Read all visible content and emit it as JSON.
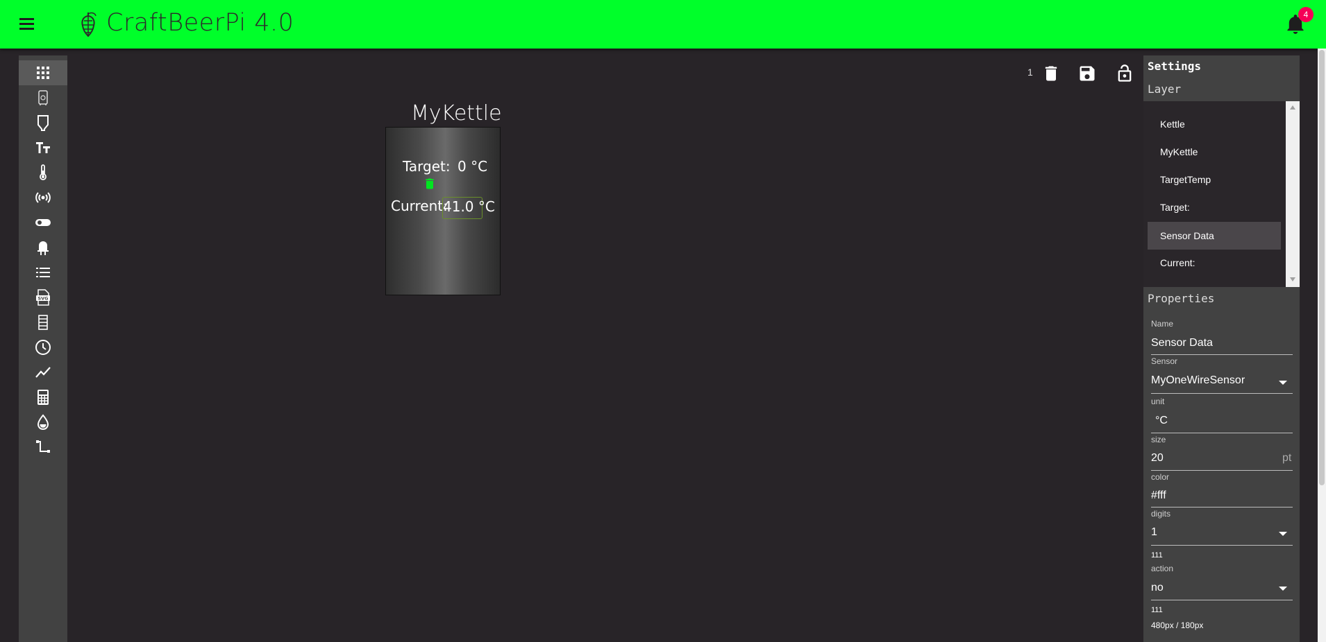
{
  "app": {
    "title": "CraftBeerPi 4.0",
    "notification_count": "4"
  },
  "sidebar": {
    "tools": [
      {
        "icon": "grid-icon"
      },
      {
        "icon": "kettle-icon"
      },
      {
        "icon": "fermenter-icon"
      },
      {
        "icon": "text-icon"
      },
      {
        "icon": "thermometer-icon"
      },
      {
        "icon": "broadcast-icon"
      },
      {
        "icon": "toggle-icon"
      },
      {
        "icon": "led-icon"
      },
      {
        "icon": "list-icon"
      },
      {
        "icon": "svg-icon"
      },
      {
        "icon": "table-icon"
      },
      {
        "icon": "clock-icon"
      },
      {
        "icon": "chart-icon"
      },
      {
        "icon": "calculator-icon"
      },
      {
        "icon": "drop-icon"
      },
      {
        "icon": "path-icon"
      }
    ]
  },
  "toolbar": {
    "dashboard_number": "1"
  },
  "canvas": {
    "kettle_name": "MyKettle",
    "target_label": "Target:",
    "target_value": "0 °C",
    "current_label": "Current:",
    "current_value": "41.0 °C"
  },
  "settings": {
    "title": "Settings",
    "layer_title": "Layer",
    "layers": [
      {
        "label": "Kettle"
      },
      {
        "label": "MyKettle"
      },
      {
        "label": "TargetTemp"
      },
      {
        "label": "Target:"
      },
      {
        "label": "Sensor Data"
      },
      {
        "label": "Current:"
      }
    ],
    "selected_layer": "Sensor Data",
    "properties_title": "Properties",
    "props": {
      "name_label": "Name",
      "name_value": "Sensor Data",
      "sensor_label": "Sensor",
      "sensor_value": "MyOneWireSensor",
      "unit_label": "unit",
      "unit_value": "°C",
      "size_label": "size",
      "size_value": "20",
      "size_unit": "pt",
      "color_label": "color",
      "color_value": "#fff",
      "digits_label": "digits",
      "digits_value": "1",
      "digits_extra": "111",
      "action_label": "action",
      "action_value": "no",
      "action_extra": "111",
      "dimensions": "480px / 180px"
    }
  },
  "colors": {
    "appbar": "#00ff2a",
    "accent_green": "#00e620",
    "badge": "#f50057"
  }
}
